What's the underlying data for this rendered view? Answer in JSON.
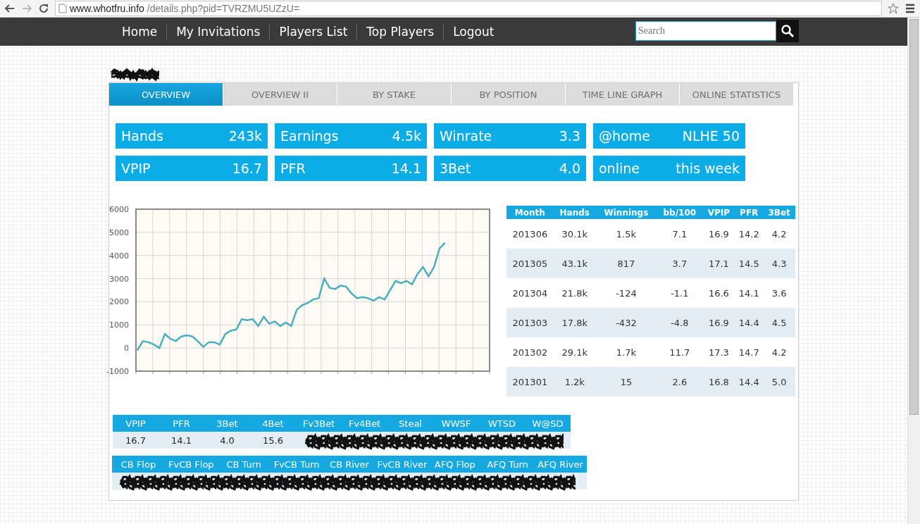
{
  "browser": {
    "url_host": "www.whotfru.info",
    "url_path": "/details.php?pid=TVRZMU5UZzU="
  },
  "nav": {
    "items": [
      {
        "label": "Home"
      },
      {
        "label": "My Invitations"
      },
      {
        "label": "Players List"
      },
      {
        "label": "Top Players"
      },
      {
        "label": "Logout"
      }
    ],
    "search": {
      "placeholder": "Search"
    }
  },
  "tabs": [
    {
      "label": "OVERVIEW",
      "selected": true
    },
    {
      "label": "OVERVIEW II",
      "selected": false
    },
    {
      "label": "BY STAKE",
      "selected": false
    },
    {
      "label": "BY POSITION",
      "selected": false
    },
    {
      "label": "TIME LINE GRAPH",
      "selected": false
    },
    {
      "label": "ONLINE STATISTICS",
      "selected": false
    }
  ],
  "stats": [
    {
      "label": "Hands",
      "value": "243k"
    },
    {
      "label": "Earnings",
      "value": "4.5k"
    },
    {
      "label": "Winrate",
      "value": "3.3"
    },
    {
      "label": "@home",
      "value": "NLHE 50"
    },
    {
      "label": "VPIP",
      "value": "16.7"
    },
    {
      "label": "PFR",
      "value": "14.1"
    },
    {
      "label": "3Bet",
      "value": "4.0"
    },
    {
      "label": "online",
      "value": "this week"
    }
  ],
  "graph": {
    "chart_data": {
      "type": "line",
      "ylim": [
        -1000,
        6000
      ],
      "yticks": [
        -1000,
        0,
        1000,
        2000,
        3000,
        4000,
        5000,
        6000
      ],
      "grid": true,
      "series": [
        {
          "color": "#4aaec0",
          "values": [
            -100,
            300,
            250,
            150,
            0,
            600,
            400,
            300,
            500,
            550,
            500,
            300,
            50,
            250,
            250,
            150,
            600,
            750,
            800,
            1250,
            1200,
            1250,
            950,
            1350,
            1050,
            1150,
            950,
            1100,
            950,
            1650,
            1850,
            1950,
            2100,
            2150,
            3000,
            2600,
            2550,
            2700,
            2650,
            2350,
            2150,
            2200,
            2150,
            2050,
            2200,
            2100,
            2500,
            2900,
            2800,
            2900,
            2750,
            3200,
            3500,
            3100,
            3500,
            4300,
            4550
          ]
        }
      ]
    }
  },
  "monthly": {
    "columns": [
      "Month",
      "Hands",
      "Winnings",
      "bb/100",
      "VPIP",
      "PFR",
      "3Bet"
    ],
    "rows": [
      [
        "201306",
        "30.1k",
        "1.5k",
        "7.1",
        "16.9",
        "14.2",
        "4.2"
      ],
      [
        "201305",
        "43.1k",
        "817",
        "3.7",
        "17.1",
        "14.5",
        "4.3"
      ],
      [
        "201304",
        "21.8k",
        "-124",
        "-1.1",
        "16.6",
        "14.1",
        "3.6"
      ],
      [
        "201303",
        "17.8k",
        "-432",
        "-4.8",
        "16.9",
        "14.4",
        "4.5"
      ],
      [
        "201302",
        "29.1k",
        "1.7k",
        "11.7",
        "17.3",
        "14.7",
        "4.2"
      ],
      [
        "201301",
        "1.2k",
        "15",
        "2.6",
        "16.8",
        "14.4",
        "5.0"
      ]
    ]
  },
  "preflop": {
    "columns": [
      "VPIP",
      "PFR",
      "3Bet",
      "4Bet",
      "Fv3Bet",
      "Fv4Bet",
      "Steal",
      "WWSF",
      "WTSD",
      "W@SD"
    ],
    "values": [
      "16.7",
      "14.1",
      "4.0",
      "15.6"
    ]
  },
  "postflop": {
    "columns": [
      "CB Flop",
      "FvCB Flop",
      "CB Turn",
      "FvCB Turn",
      "CB River",
      "FvCB River",
      "AFQ Flop",
      "AFQ Turn",
      "AFQ River"
    ]
  }
}
